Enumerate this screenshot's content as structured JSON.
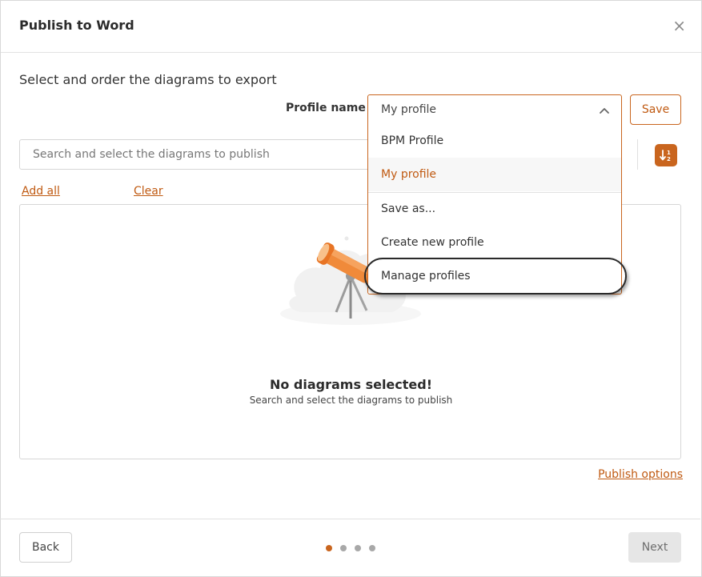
{
  "dialog": {
    "title": "Publish to Word",
    "close_glyph": "×",
    "subtitle": "Select and order the diagrams to export"
  },
  "profile": {
    "label": "Profile name",
    "selected": "My profile",
    "save_label": "Save",
    "options": [
      {
        "label": "BPM Profile",
        "selected": false
      },
      {
        "label": "My profile",
        "selected": true
      }
    ],
    "actions": [
      {
        "label": "Save as..."
      },
      {
        "label": "Create new profile"
      },
      {
        "label": "Manage profiles"
      }
    ]
  },
  "search": {
    "placeholder": "Search and select the diagrams to publish"
  },
  "links": {
    "add_all": "Add all",
    "clear": "Clear",
    "publish_options": "Publish options"
  },
  "empty_state": {
    "title": "No diagrams selected!",
    "subtitle": "Search and select the diagrams to publish",
    "illustration_icon": "telescope-icon"
  },
  "footer": {
    "back_label": "Back",
    "next_label": "Next",
    "steps_total": 4,
    "current_step": 1
  },
  "colors": {
    "accent": "#c9651e",
    "accent_text": "#c05a12",
    "disabled_bg": "#e6e6e6"
  }
}
